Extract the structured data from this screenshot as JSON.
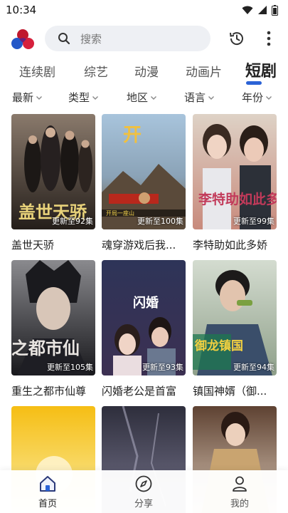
{
  "status_bar": {
    "time": "10:34",
    "icons": [
      "wifi-icon",
      "signal-icon",
      "battery-icon"
    ]
  },
  "top_bar": {
    "logo": "app-logo",
    "search_placeholder": "搜索",
    "search_icon": "search-icon",
    "history_icon": "history-icon",
    "more_icon": "more-vertical-icon"
  },
  "tabs": [
    {
      "label": "连续剧",
      "active": false
    },
    {
      "label": "综艺",
      "active": false
    },
    {
      "label": "动漫",
      "active": false
    },
    {
      "label": "动画片",
      "active": false
    },
    {
      "label": "短剧",
      "active": true
    }
  ],
  "accent_color": "#2b63d6",
  "filters": [
    {
      "label": "最新"
    },
    {
      "label": "类型"
    },
    {
      "label": "地区"
    },
    {
      "label": "语言"
    },
    {
      "label": "年份"
    }
  ],
  "cards": [
    {
      "title": "盖世天骄",
      "badge": "更新至92集",
      "poster_colors": [
        "#6b5d52",
        "#2a2420"
      ],
      "poster_text": "盖世天骄"
    },
    {
      "title": "魂穿游戏后我...",
      "badge": "更新至100集",
      "poster_colors": [
        "#9fb7cf",
        "#7a5a2e"
      ],
      "poster_text": "开局一座山"
    },
    {
      "title": "李特助如此多娇",
      "badge": "更新至99集",
      "poster_colors": [
        "#d8c8b8",
        "#c98a7a"
      ],
      "poster_text": "李特助如此多娇"
    },
    {
      "title": "重生之都市仙尊",
      "badge": "更新至105集",
      "poster_colors": [
        "#6e6e72",
        "#1c1c20"
      ],
      "poster_text": "之都市仙"
    },
    {
      "title": "闪婚老公是首富",
      "badge": "更新至93集",
      "poster_colors": [
        "#3a3f66",
        "#1d2140"
      ],
      "poster_text": "闪婚"
    },
    {
      "title": "镇国神婿（御...",
      "badge": "更新至94集",
      "poster_colors": [
        "#c9d2c4",
        "#5f7a5a"
      ],
      "poster_text": "御龙镇国"
    },
    {
      "title": "",
      "badge": "",
      "poster_colors": [
        "#f6c21a",
        "#f7f1d6"
      ],
      "poster_text": ""
    },
    {
      "title": "",
      "badge": "",
      "poster_colors": [
        "#3a3a4a",
        "#7a7890"
      ],
      "poster_text": ""
    },
    {
      "title": "",
      "badge": "",
      "poster_colors": [
        "#6a4a3a",
        "#e8d8c8"
      ],
      "poster_text": ""
    }
  ],
  "bottom_nav": [
    {
      "label": "首页",
      "icon": "home-icon",
      "active": true
    },
    {
      "label": "分享",
      "icon": "compass-icon",
      "active": false
    },
    {
      "label": "我的",
      "icon": "user-icon",
      "active": false
    }
  ]
}
